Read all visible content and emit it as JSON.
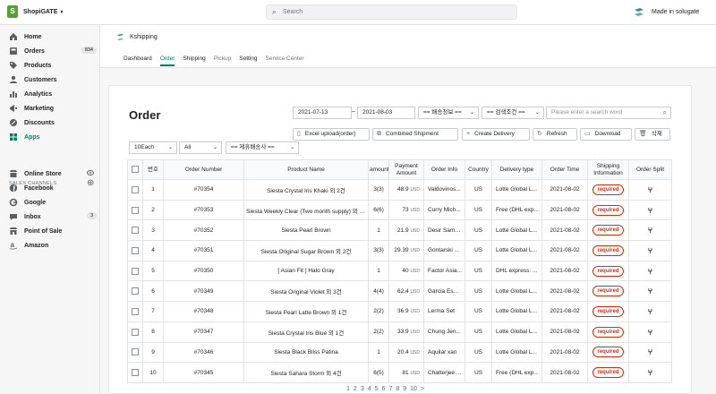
{
  "topbar": {
    "store_name": "ShopiGATE",
    "search_placeholder": "Search",
    "account_label": "Made in solugate"
  },
  "sidebar": {
    "items": [
      {
        "label": "Home",
        "icon": "home-icon"
      },
      {
        "label": "Orders",
        "icon": "orders-icon",
        "badge": "834"
      },
      {
        "label": "Products",
        "icon": "tag-icon"
      },
      {
        "label": "Customers",
        "icon": "person-icon"
      },
      {
        "label": "Analytics",
        "icon": "analytics-icon"
      },
      {
        "label": "Marketing",
        "icon": "marketing-icon"
      },
      {
        "label": "Discounts",
        "icon": "discount-icon"
      },
      {
        "label": "Apps",
        "icon": "apps-icon"
      }
    ],
    "channels_title": "SALES CHANNELS",
    "channels": [
      {
        "label": "Online Store",
        "icon": "store-icon"
      },
      {
        "label": "Facebook",
        "icon": "facebook-icon"
      },
      {
        "label": "Google",
        "icon": "google-icon"
      },
      {
        "label": "Inbox",
        "icon": "inbox-icon",
        "badge": "3"
      },
      {
        "label": "Point of Sale",
        "icon": "pos-icon"
      },
      {
        "label": "Amazon",
        "icon": "amazon-icon"
      }
    ]
  },
  "app": {
    "name": "Kshipping",
    "tabs": [
      "Dashboard",
      "Order",
      "Shipping",
      "Pickup",
      "Setting",
      "Service Center"
    ]
  },
  "order": {
    "title": "Order",
    "date_from": "2021-07-13",
    "date_to": "2021-08-03",
    "tilde": "~",
    "shipping_info_select": "== 배송정보 ==",
    "search_cond_select": "== 검색조건 ==",
    "search_placeholder": "Please enter a search word",
    "page_size": "10Each",
    "status_filter": "All",
    "carrier_filter": "== 제휴배송사 ==",
    "buttons": {
      "excel": "Excel upload(order)",
      "combined": "Combined Shipment",
      "create": "Create Delivery",
      "refresh": "Refresh",
      "download": "Download",
      "delete": "삭제"
    },
    "columns": [
      "번호",
      "Order Number",
      "Product Name",
      "amount",
      "Payment Amount",
      "Order Info",
      "Country",
      "Delivery type",
      "Order Time",
      "Shipping Information",
      "Order Split"
    ],
    "rows": [
      {
        "no": "1",
        "order": "#70354",
        "product": "Siesta Crystal Iris Khaki 외 2건",
        "amount": "3(3)",
        "pay": "48.9",
        "info": "Valdovinos...",
        "country": "US",
        "delivery": "Lotte Global L...",
        "time": "2021-08-02",
        "ship": "required"
      },
      {
        "no": "2",
        "order": "#70353",
        "product": "Siesta Weekly Clear (Two month supply) 외 5건",
        "amount": "6(6)",
        "pay": "73",
        "info": "Curry Mich...",
        "country": "US",
        "delivery": "Free (DHL exp...",
        "time": "2021-08-02",
        "ship": "required"
      },
      {
        "no": "3",
        "order": "#70352",
        "product": "Siesta Pearl Brown",
        "amount": "1",
        "pay": "21.9",
        "info": "Desir Sama...",
        "country": "US",
        "delivery": "Lotte Global L...",
        "time": "2021-08-02",
        "ship": "required"
      },
      {
        "no": "4",
        "order": "#70351",
        "product": "Siesta Original Sugar Brown 외 2건",
        "amount": "3(3)",
        "pay": "29.39",
        "info": "Gontarski ...",
        "country": "US",
        "delivery": "Lotte Global L...",
        "time": "2021-08-02",
        "ship": "required"
      },
      {
        "no": "5",
        "order": "#70350",
        "product": "[ Asian Fit ] Halo Gray",
        "amount": "1",
        "pay": "40",
        "info": "Factor Asia...",
        "country": "US",
        "delivery": "DHL express: ...",
        "time": "2021-08-02",
        "ship": "required"
      },
      {
        "no": "6",
        "order": "#70349",
        "product": "Siesta Original Violet 외 3건",
        "amount": "4(4)",
        "pay": "62.4",
        "info": "Garcia Esm...",
        "country": "US",
        "delivery": "Lotte Global L...",
        "time": "2021-08-02",
        "ship": "required"
      },
      {
        "no": "7",
        "order": "#70348",
        "product": "Siesta Pearl Latte Brown 외 1건",
        "amount": "2(2)",
        "pay": "36.9",
        "info": "Lerma Set",
        "country": "US",
        "delivery": "Lotte Global L...",
        "time": "2021-08-02",
        "ship": "required"
      },
      {
        "no": "8",
        "order": "#70347",
        "product": "Siesta Crystal Iris Blue 외 1건",
        "amount": "2(2)",
        "pay": "33.9",
        "info": "Chung Jen...",
        "country": "US",
        "delivery": "Lotte Global L...",
        "time": "2021-08-02",
        "ship": "required"
      },
      {
        "no": "9",
        "order": "#70346",
        "product": "Siesta Black Bliss Patina",
        "amount": "1",
        "pay": "20.4",
        "info": "Aquilar xan",
        "country": "US",
        "delivery": "Lotte Global L...",
        "time": "2021-08-02",
        "ship": "required"
      },
      {
        "no": "10",
        "order": "#70345",
        "product": "Siesta Sahara Storm 외 4건",
        "amount": "6(5)",
        "pay": "81",
        "info": "Chatterjee ...",
        "country": "US",
        "delivery": "Free (DHL exp...",
        "time": "2021-08-02",
        "ship": "required"
      }
    ],
    "currency": "USD",
    "pages": [
      "1",
      "2",
      "3",
      "4",
      "5",
      "6",
      "7",
      "8",
      "9",
      "10",
      ">"
    ]
  },
  "colors": {
    "accent": "#008060",
    "required": "#d82c0d",
    "link": "#2c6ecb"
  }
}
